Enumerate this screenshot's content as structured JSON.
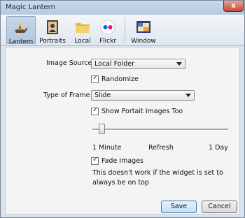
{
  "window": {
    "title": "Magic Lantern",
    "close_glyph": "x"
  },
  "toolbar": {
    "items": [
      {
        "label": "Lantern",
        "icon": "lantern-icon",
        "active": true
      },
      {
        "label": "Portraits",
        "icon": "portraits-icon",
        "active": false
      },
      {
        "label": "Local",
        "icon": "folder-icon",
        "active": false
      },
      {
        "label": "Flickr",
        "icon": "flickr-icon",
        "active": false
      },
      {
        "label": "Window",
        "icon": "window-icon",
        "active": false
      }
    ]
  },
  "settings": {
    "image_source": {
      "label": "Image Source",
      "value": "Local Folder"
    },
    "randomize": {
      "label": "Randomize",
      "checked": true
    },
    "type_of_frame": {
      "label": "Type of Frame",
      "value": "Slide"
    },
    "show_portrait": {
      "label": "Show Portait Images Too",
      "checked": true
    },
    "refresh": {
      "label": "Refresh",
      "min_label": "1 Minute",
      "max_label": "1 Day",
      "level": 0.05
    },
    "fade_images": {
      "label": "Fade Images",
      "checked": true,
      "note": "This doesn't work if the widget is set to always be on top"
    }
  },
  "footer": {
    "save_label": "Save",
    "cancel_label": "Cancel"
  }
}
